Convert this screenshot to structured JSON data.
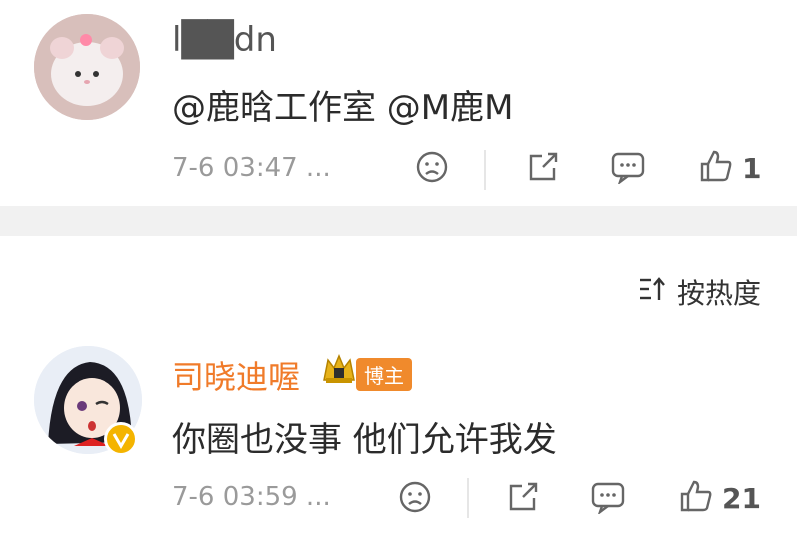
{
  "comment1": {
    "username": "l██dn",
    "text": "@鹿晗工作室 @M鹿M",
    "meta": "7-6 03:47 ...",
    "like_count": "1"
  },
  "sort": {
    "label": "按热度"
  },
  "comment2": {
    "username": "司晓迪喔",
    "badge_label": "博主",
    "text": "你圈也没事 他们允许我发",
    "meta": "7-6 03:59 ...",
    "like_count": "21"
  },
  "colors": {
    "username_orange": "#f07b2a",
    "badge_orange": "#f08a2c",
    "verified_badge": "#f4b400"
  }
}
